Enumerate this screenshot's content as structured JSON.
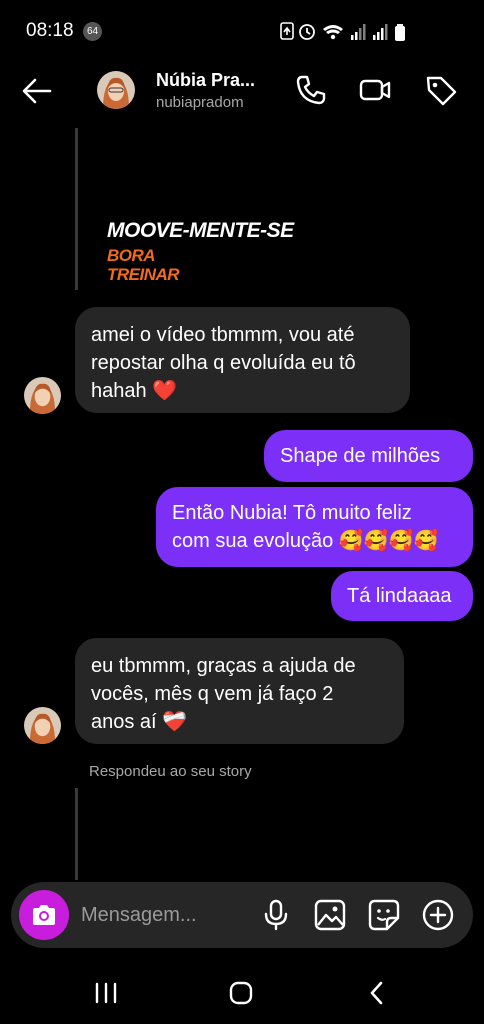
{
  "status": {
    "time": "08:18",
    "badge": "64"
  },
  "contact": {
    "name": "Núbia Pra...",
    "username": "nubiapradom"
  },
  "story_preview": {
    "title": "MOOVE-MENTE-SE",
    "subtitle_line1": "BORA",
    "subtitle_line2": "TREINAR"
  },
  "messages": [
    {
      "from": "them",
      "lines": [
        "amei o vídeo tbmmm, vou até",
        "repostar olha q evoluída eu tô",
        "hahah ❤️"
      ]
    },
    {
      "from": "me",
      "text": "Shape de milhões"
    },
    {
      "from": "me",
      "lines": [
        "Então Nubia! Tô muito feliz",
        "com sua evolução 🥰🥰🥰🥰"
      ]
    },
    {
      "from": "me",
      "text": "Tá lindaaaa"
    },
    {
      "from": "them",
      "lines": [
        "eu tbmmm, graças a ajuda de",
        "vocês, mês q vem já faço 2",
        "anos aí ❤️‍🩹"
      ]
    }
  ],
  "reply_label": "Respondeu ao seu story",
  "composer": {
    "placeholder": "Mensagem..."
  },
  "colors": {
    "outgoing": "#7b2ff7",
    "incoming": "#262626",
    "camera": "#c81ddc",
    "story_accent": "#f26a1b"
  }
}
